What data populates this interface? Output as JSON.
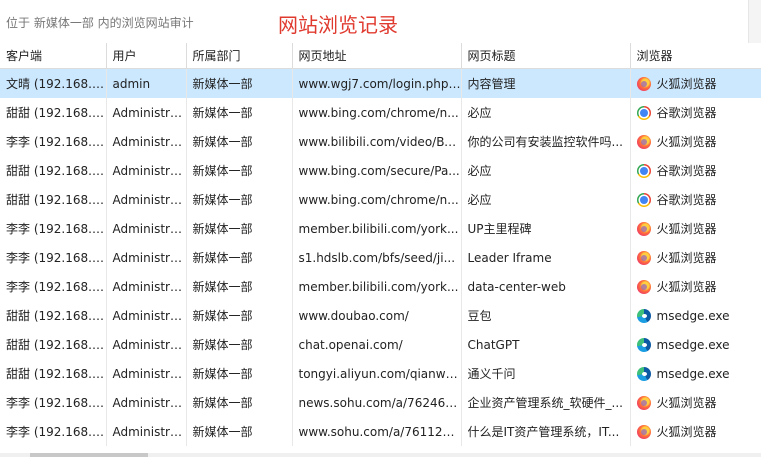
{
  "header": {
    "location": "位于  新媒体一部  内的浏览网站审计",
    "title": "网站浏览记录"
  },
  "columns": [
    "客户端",
    "用户",
    "所属部门",
    "网页地址",
    "网页标题",
    "浏览器"
  ],
  "rows": [
    {
      "client": "文晴 (192.168.1...",
      "user": "admin",
      "dept": "新媒体一部",
      "url": "www.wgj7.com/login.php?...",
      "page_title": "内容管理",
      "browser": "火狐浏览器",
      "icon": "firefox-icon",
      "selected": true
    },
    {
      "client": "甜甜 (192.168.1...",
      "user": "Administra...",
      "dept": "新媒体一部",
      "url": "www.bing.com/chrome/n...",
      "page_title": "必应",
      "browser": "谷歌浏览器",
      "icon": "chrome-icon"
    },
    {
      "client": "李李 (192.168.1...",
      "user": "Administra...",
      "dept": "新媒体一部",
      "url": "www.bilibili.com/video/BV...",
      "page_title": "你的公司有安装监控软件吗...",
      "browser": "火狐浏览器",
      "icon": "firefox-icon"
    },
    {
      "client": "甜甜 (192.168.1...",
      "user": "Administra...",
      "dept": "新媒体一部",
      "url": "www.bing.com/secure/Pa...",
      "page_title": "必应",
      "browser": "谷歌浏览器",
      "icon": "chrome-icon"
    },
    {
      "client": "甜甜 (192.168.1...",
      "user": "Administra...",
      "dept": "新媒体一部",
      "url": "www.bing.com/chrome/n...",
      "page_title": "必应",
      "browser": "谷歌浏览器",
      "icon": "chrome-icon"
    },
    {
      "client": "李李 (192.168.1...",
      "user": "Administra...",
      "dept": "新媒体一部",
      "url": "member.bilibili.com/york...",
      "page_title": "UP主里程碑",
      "browser": "火狐浏览器",
      "icon": "firefox-icon"
    },
    {
      "client": "李李 (192.168.1...",
      "user": "Administra...",
      "dept": "新媒体一部",
      "url": "s1.hdslb.com/bfs/seed/ji...",
      "page_title": "Leader Iframe",
      "browser": "火狐浏览器",
      "icon": "firefox-icon"
    },
    {
      "client": "李李 (192.168.1...",
      "user": "Administra...",
      "dept": "新媒体一部",
      "url": "member.bilibili.com/york...",
      "page_title": "data-center-web",
      "browser": "火狐浏览器",
      "icon": "firefox-icon"
    },
    {
      "client": "甜甜 (192.168.1...",
      "user": "Administra...",
      "dept": "新媒体一部",
      "url": "www.doubao.com/",
      "page_title": "豆包",
      "browser": "msedge.exe",
      "icon": "edge-icon"
    },
    {
      "client": "甜甜 (192.168.1...",
      "user": "Administra...",
      "dept": "新媒体一部",
      "url": "chat.openai.com/",
      "page_title": "ChatGPT",
      "browser": "msedge.exe",
      "icon": "edge-icon"
    },
    {
      "client": "甜甜 (192.168.1...",
      "user": "Administra...",
      "dept": "新媒体一部",
      "url": "tongyi.aliyun.com/qianwe...",
      "page_title": "通义千问",
      "browser": "msedge.exe",
      "icon": "edge-icon"
    },
    {
      "client": "李李 (192.168.1...",
      "user": "Administra...",
      "dept": "新媒体一部",
      "url": "news.sohu.com/a/762465...",
      "page_title": "企业资产管理系统_软硬件_...",
      "browser": "火狐浏览器",
      "icon": "firefox-icon"
    },
    {
      "client": "李李 (192.168.1...",
      "user": "Administra...",
      "dept": "新媒体一部",
      "url": "www.sohu.com/a/761125...",
      "page_title": "什么是IT资产管理系统，IT...",
      "browser": "火狐浏览器",
      "icon": "firefox-icon"
    }
  ],
  "colors": {
    "selected_row": "#cce8ff",
    "title": "#e03a2f"
  }
}
